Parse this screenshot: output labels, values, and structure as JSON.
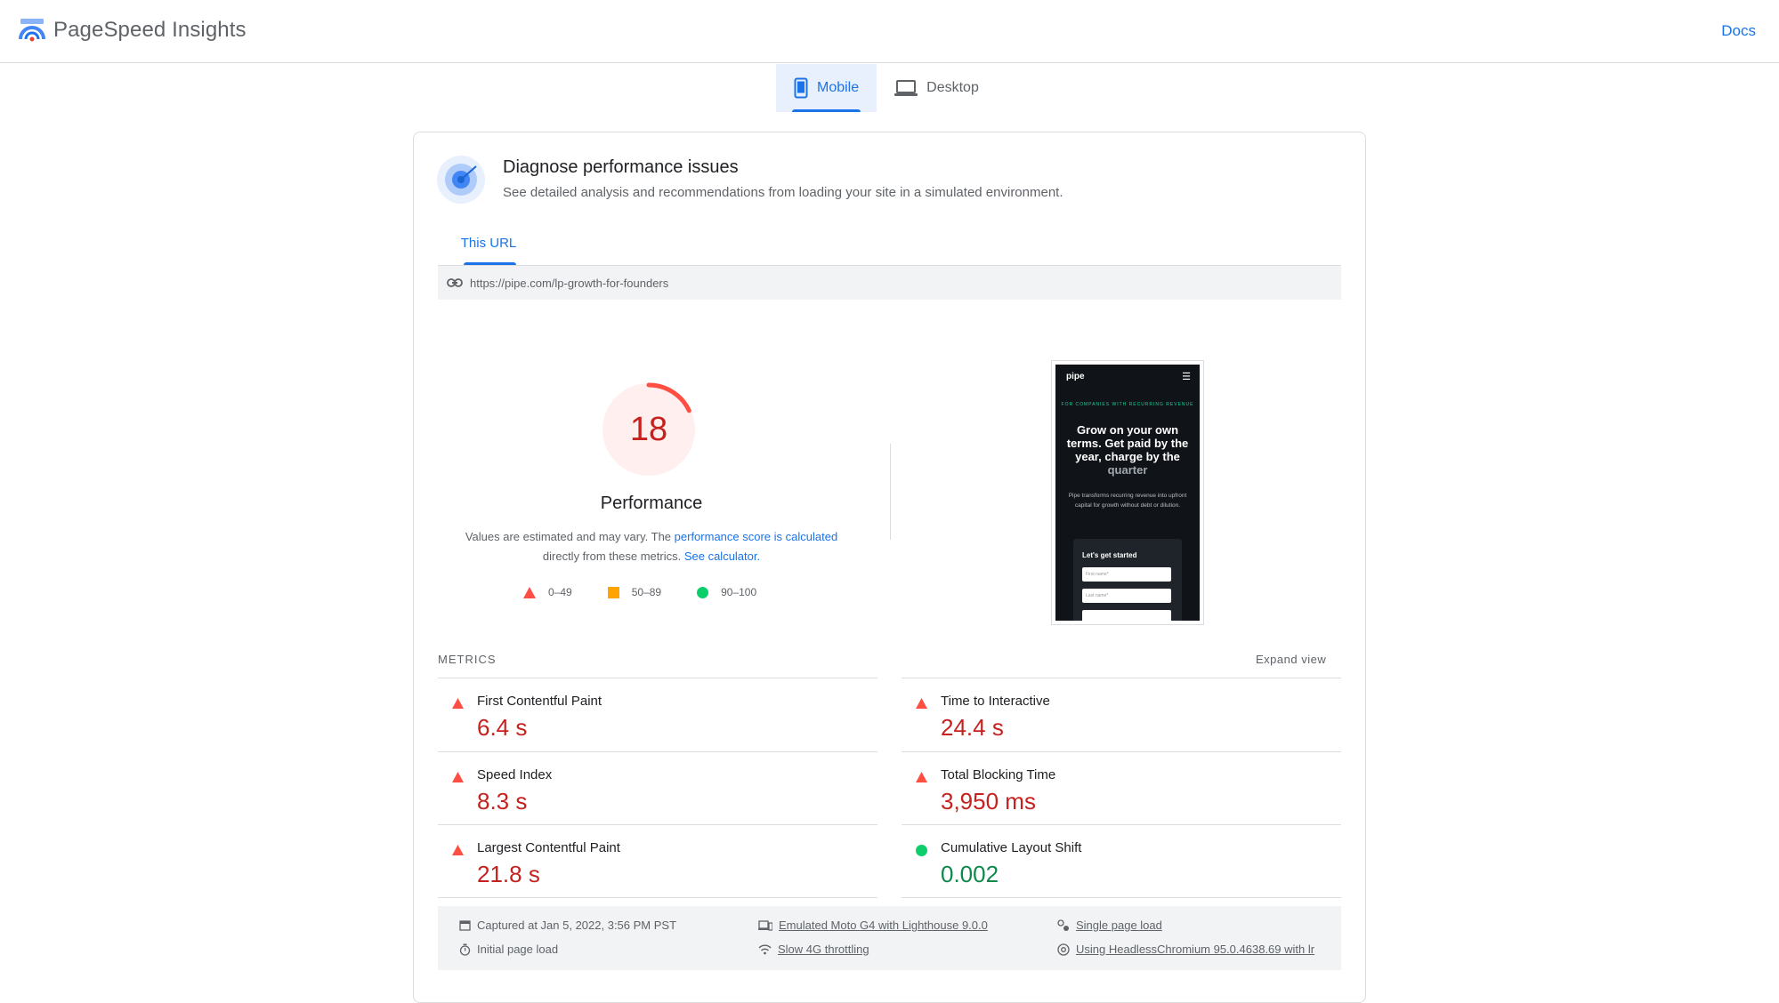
{
  "header": {
    "title": "PageSpeed Insights",
    "docs_label": "Docs"
  },
  "device_tabs": [
    {
      "label": "Mobile",
      "icon": "smartphone-icon",
      "active": true
    },
    {
      "label": "Desktop",
      "icon": "laptop-icon",
      "active": false
    }
  ],
  "diagnose": {
    "title": "Diagnose performance issues",
    "subtitle": "See detailed analysis and recommendations from loading your site in a simulated environment."
  },
  "url_tab": "This URL",
  "url": "https://pipe.com/lp-growth-for-founders",
  "performance": {
    "score": "18",
    "score_fraction": 0.18,
    "title": "Performance",
    "note_prefix": "Values are estimated and may vary. The ",
    "note_link1": "performance score is calculated",
    "note_mid": "directly from these metrics. ",
    "note_link2": "See calculator.",
    "legend": [
      "0–49",
      "50–89",
      "90–100"
    ],
    "colors": {
      "fail": "#ff4e42",
      "average": "#ffa400",
      "pass": "#0cce6b"
    }
  },
  "screenshot": {
    "logo": "pipe",
    "kicker": "FOR COMPANIES WITH RECURRING REVENUE",
    "headline": "Grow on your own terms. Get paid by the year, charge by the",
    "headline_accent": "quarter",
    "body": "Pipe transforms recurring revenue into upfront capital for growth without debt or dilution.",
    "form_title": "Let's get started",
    "field1": "First name*",
    "field2": "Last name*"
  },
  "metrics": {
    "label": "METRICS",
    "expand": "Expand view",
    "items": [
      {
        "name": "First Contentful Paint",
        "value": "6.4 s",
        "status": "fail"
      },
      {
        "name": "Time to Interactive",
        "value": "24.4 s",
        "status": "fail"
      },
      {
        "name": "Speed Index",
        "value": "8.3 s",
        "status": "fail"
      },
      {
        "name": "Total Blocking Time",
        "value": "3,950 ms",
        "status": "fail"
      },
      {
        "name": "Largest Contentful Paint",
        "value": "21.8 s",
        "status": "fail"
      },
      {
        "name": "Cumulative Layout Shift",
        "value": "0.002",
        "status": "pass"
      }
    ]
  },
  "info": {
    "captured": "Captured at Jan 5, 2022, 3:56 PM PST",
    "initial": "Initial page load",
    "device": "Emulated Moto G4 with Lighthouse 9.0.0",
    "throttling": "Slow 4G throttling",
    "single": "Single page load",
    "browser": "Using HeadlessChromium 95.0.4638.69 with lr"
  }
}
